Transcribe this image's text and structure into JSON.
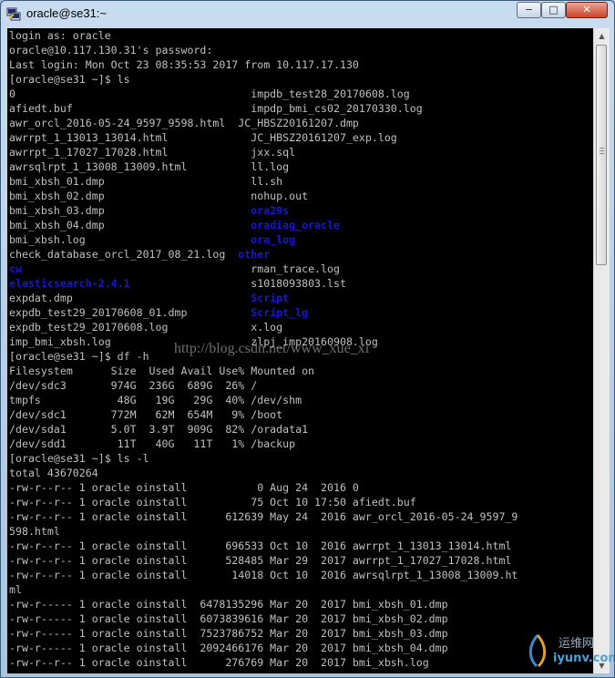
{
  "window": {
    "title": "oracle@se31:~",
    "controls": {
      "minimize": "−",
      "maximize": "□",
      "close": "✕"
    }
  },
  "terminal": {
    "lines": [
      [
        {
          "t": "login as: oracle"
        }
      ],
      [
        {
          "t": "oracle@10.117.130.31's password:"
        }
      ],
      [
        {
          "t": "Last login: Mon Oct 23 08:35:53 2017 from 10.117.17.130"
        }
      ],
      [
        {
          "t": "[oracle@se31 ~]$ ls"
        }
      ],
      [
        {
          "t": "0                                     impdb_test28_20170608.log"
        }
      ],
      [
        {
          "t": "afiedt.buf                            impdp_bmi_cs02_20170330.log"
        }
      ],
      [
        {
          "t": "awr_orcl_2016-05-24_9597_9598.html  JC_HBSZ20161207.dmp"
        }
      ],
      [
        {
          "t": "awrrpt_1_13013_13014.html             JC_HBSZ20161207_exp.log"
        }
      ],
      [
        {
          "t": "awrrpt_1_17027_17028.html             jxx.sql"
        }
      ],
      [
        {
          "t": "awrsqlrpt_1_13008_13009.html          ll.log"
        }
      ],
      [
        {
          "t": "bmi_xbsh_01.dmp                       ll.sh"
        }
      ],
      [
        {
          "t": "bmi_xbsh_02.dmp                       nohup.out"
        }
      ],
      [
        {
          "t": "bmi_xbsh_03.dmp                       "
        },
        {
          "t": "ora29s",
          "c": "blue"
        }
      ],
      [
        {
          "t": "bmi_xbsh_04.dmp                       "
        },
        {
          "t": "oradiag_oracle",
          "c": "blue"
        }
      ],
      [
        {
          "t": "bmi_xbsh.log                          "
        },
        {
          "t": "ora_log",
          "c": "blue"
        }
      ],
      [
        {
          "t": "check_database_orcl_2017_08_21.log  "
        },
        {
          "t": "other",
          "c": "blue"
        }
      ],
      [
        {
          "t": "cw",
          "c": "blue"
        },
        {
          "t": "                                    rman_trace.log"
        }
      ],
      [
        {
          "t": "elasticsearch-2.4.1",
          "c": "blue"
        },
        {
          "t": "                   s1018093803.lst"
        }
      ],
      [
        {
          "t": "expdat.dmp                            "
        },
        {
          "t": "Script",
          "c": "blue"
        }
      ],
      [
        {
          "t": "expdb_test29_20170608_01.dmp          "
        },
        {
          "t": "Script_lg",
          "c": "blue"
        }
      ],
      [
        {
          "t": "expdb_test29_20170608.log             x.log"
        }
      ],
      [
        {
          "t": "imp_bmi_xbsh.log                      zlpj_imp20160908.log"
        }
      ],
      [
        {
          "t": "[oracle@se31 ~]$ df -h"
        }
      ],
      [
        {
          "t": "Filesystem      Size  Used Avail Use% Mounted on"
        }
      ],
      [
        {
          "t": "/dev/sdc3       974G  236G  689G  26% /"
        }
      ],
      [
        {
          "t": "tmpfs            48G   19G   29G  40% /dev/shm"
        }
      ],
      [
        {
          "t": "/dev/sdc1       772M   62M  654M   9% /boot"
        }
      ],
      [
        {
          "t": "/dev/sda1       5.0T  3.9T  909G  82% /oradata1"
        }
      ],
      [
        {
          "t": "/dev/sdd1        11T   40G   11T   1% /backup"
        }
      ],
      [
        {
          "t": "[oracle@se31 ~]$ ls -l"
        }
      ],
      [
        {
          "t": "total 43670264"
        }
      ],
      [
        {
          "t": "-rw-r--r-- 1 oracle oinstall           0 Aug 24  2016 0"
        }
      ],
      [
        {
          "t": "-rw-r--r-- 1 oracle oinstall          75 Oct 10 17:50 afiedt.buf"
        }
      ],
      [
        {
          "t": "-rw-r--r-- 1 oracle oinstall      612639 May 24  2016 awr_orcl_2016-05-24_9597_9"
        }
      ],
      [
        {
          "t": "598.html"
        }
      ],
      [
        {
          "t": "-rw-r--r-- 1 oracle oinstall      696533 Oct 10  2016 awrrpt_1_13013_13014.html"
        }
      ],
      [
        {
          "t": "-rw-r--r-- 1 oracle oinstall      528485 Mar 29  2017 awrrpt_1_17027_17028.html"
        }
      ],
      [
        {
          "t": "-rw-r--r-- 1 oracle oinstall       14018 Oct 10  2016 awrsqlrpt_1_13008_13009.ht"
        }
      ],
      [
        {
          "t": "ml"
        }
      ],
      [
        {
          "t": "-rw-r----- 1 oracle oinstall  6478135296 Mar 20  2017 bmi_xbsh_01.dmp"
        }
      ],
      [
        {
          "t": "-rw-r----- 1 oracle oinstall  6073839616 Mar 20  2017 bmi_xbsh_02.dmp"
        }
      ],
      [
        {
          "t": "-rw-r----- 1 oracle oinstall  7523786752 Mar 20  2017 bmi_xbsh_03.dmp"
        }
      ],
      [
        {
          "t": "-rw-r----- 1 oracle oinstall  2092466176 Mar 20  2017 bmi_xbsh_04.dmp"
        }
      ],
      [
        {
          "t": "-rw-r--r-- 1 oracle oinstall      276769 Mar 20  2017 bmi_xbsh.log"
        }
      ]
    ]
  },
  "watermark": "http://blog.csdn.net/www_xue_xi",
  "logo": {
    "line1": "运维网",
    "line2": "iyunv.com"
  },
  "colors": {
    "terminal_bg": "#000000",
    "text": "#c0c0c0",
    "directory": "#1717d6"
  },
  "icons": {
    "app": "putty-icon",
    "scroll_up": "arrow-up-icon",
    "scroll_down": "arrow-down-icon"
  }
}
